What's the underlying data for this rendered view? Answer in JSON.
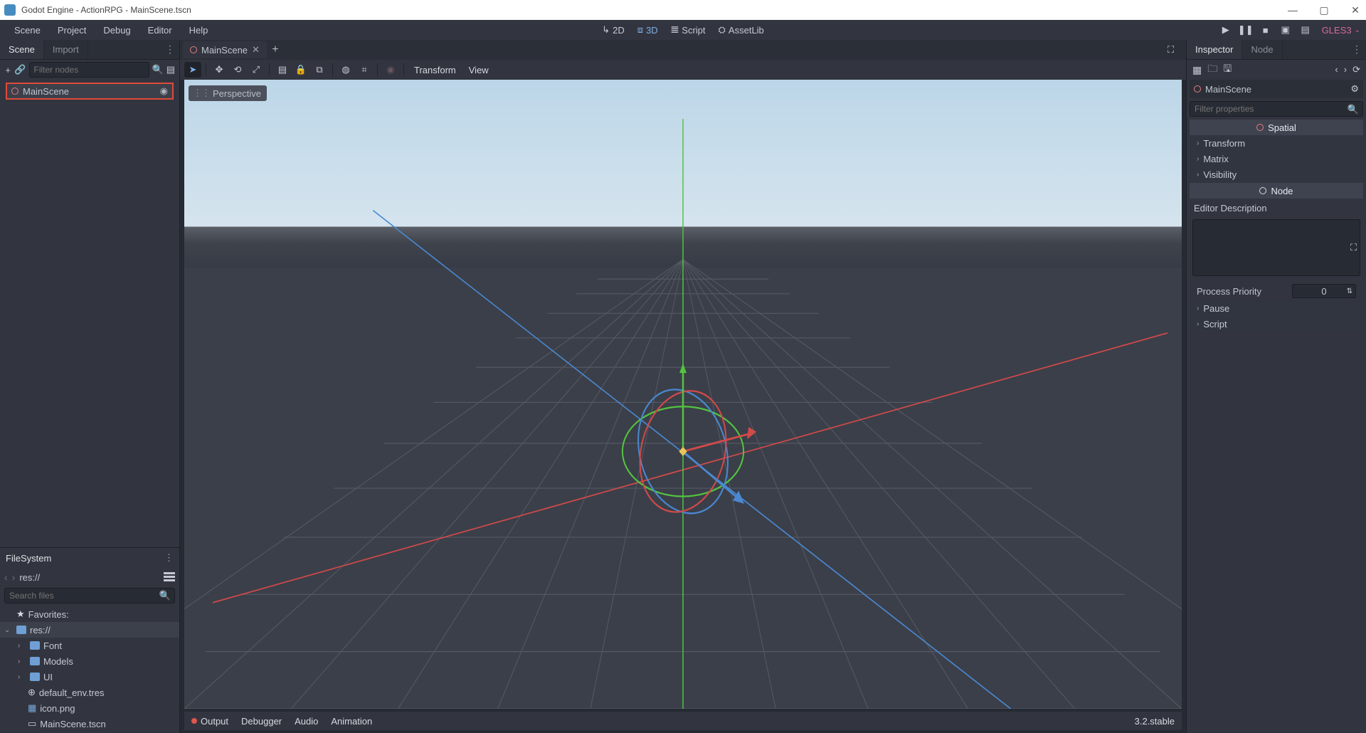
{
  "window": {
    "title": "Godot Engine - ActionRPG - MainScene.tscn"
  },
  "menus": {
    "scene": "Scene",
    "project": "Project",
    "debug": "Debug",
    "editor": "Editor",
    "help": "Help"
  },
  "workspace_buttons": {
    "mode_2d": "2D",
    "mode_3d": "3D",
    "script": "Script",
    "assetlib": "AssetLib"
  },
  "renderer": "GLES3",
  "left_panel": {
    "tabs": {
      "scene": "Scene",
      "import": "Import"
    },
    "filter_placeholder": "Filter nodes",
    "root_node": "MainScene"
  },
  "filesystem": {
    "title": "FileSystem",
    "path": "res://",
    "search_placeholder": "Search files",
    "favorites_label": "Favorites:",
    "root": "res://",
    "folders": [
      "Font",
      "Models",
      "UI"
    ],
    "files": [
      "default_env.tres",
      "icon.png",
      "MainScene.tscn"
    ]
  },
  "center": {
    "open_scene": "MainScene",
    "perspective_label": "Perspective",
    "transform_menu": "Transform",
    "view_menu": "View"
  },
  "bottom_panel": {
    "output": "Output",
    "debugger": "Debugger",
    "audio": "Audio",
    "animation": "Animation",
    "version": "3.2.stable"
  },
  "inspector": {
    "tabs": {
      "inspector": "Inspector",
      "node": "Node"
    },
    "node_name": "MainScene",
    "filter_placeholder": "Filter properties",
    "section_spatial": "Spatial",
    "props_spatial": [
      "Transform",
      "Matrix",
      "Visibility"
    ],
    "section_node": "Node",
    "editor_description_label": "Editor Description",
    "process_priority_label": "Process Priority",
    "process_priority_value": "0",
    "props_node": [
      "Pause",
      "Script"
    ]
  }
}
